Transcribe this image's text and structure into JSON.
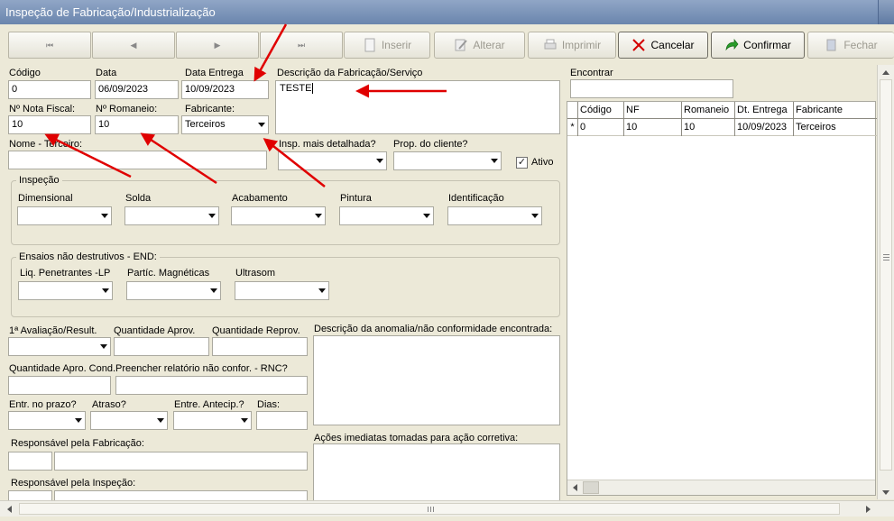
{
  "window": {
    "title": "Inspeção de Fabricação/Industrialização"
  },
  "nav": {
    "first": "⏮",
    "prev": "◀",
    "next": "▶",
    "last": "⏭"
  },
  "toolbar": {
    "insert": "Inserir",
    "edit": "Alterar",
    "print": "Imprimir",
    "cancel": "Cancelar",
    "confirm": "Confirmar",
    "close": "Fechar"
  },
  "form": {
    "codigo": {
      "label": "Código",
      "value": "0"
    },
    "data": {
      "label": "Data",
      "value": "06/09/2023"
    },
    "data_entrega": {
      "label": "Data Entrega",
      "value": "10/09/2023"
    },
    "descricao": {
      "label": "Descrição da Fabricação/Serviço",
      "value": "TESTE"
    },
    "nota_fiscal": {
      "label": "Nº Nota Fiscal:",
      "value": "10"
    },
    "romaneio": {
      "label": "Nº Romaneio:",
      "value": "10"
    },
    "fabricante": {
      "label": "Fabricante:",
      "value": "Terceiros"
    },
    "nome_terceiro": {
      "label": "Nome - Terceiro:",
      "value": ""
    },
    "insp_detalhada": {
      "label": "Insp. mais detalhada?",
      "value": ""
    },
    "prop_cliente": {
      "label": "Prop. do cliente?",
      "value": ""
    },
    "ativo": {
      "label": "Ativo",
      "checked": "✓"
    },
    "inspecao": {
      "title": "Inspeção",
      "dimensional": "Dimensional",
      "solda": "Solda",
      "acabamento": "Acabamento",
      "pintura": "Pintura",
      "identificacao": "Identificação"
    },
    "end": {
      "title": "Ensaios não destrutivos - END:",
      "liq": "Liq. Penetrantes -LP",
      "mag": "Partíc. Magnéticas",
      "ultra": "Ultrasom"
    },
    "avaliacao": "1ª Avaliação/Result.",
    "qtd_aprov": "Quantidade Aprov.",
    "qtd_reprov": "Quantidade Reprov.",
    "anomalia": "Descrição da anomalia/não conformidade encontrada:",
    "qtd_aprov_cond": "Quantidade Apro. Cond.",
    "rnc": "Preencher relatório não confor. - RNC?",
    "entr_prazo": "Entr. no prazo?",
    "atraso": "Atraso?",
    "entr_antecip": "Entre. Antecip.?",
    "dias": "Dias:",
    "resp_fabricacao": "Responsável pela Fabricação:",
    "acoes": "Ações imediatas tomadas para ação corretiva:",
    "resp_inspecao": "Responsável pela Inspeção:"
  },
  "search": {
    "label": "Encontrar",
    "value": ""
  },
  "grid": {
    "columns": [
      "Código",
      "NF",
      "Romaneio",
      "Dt. Entrega",
      "Fabricante"
    ],
    "rows": [
      {
        "marker": "*",
        "codigo": "0",
        "nf": "10",
        "romaneio": "10",
        "dt_entrega": "10/09/2023",
        "fabricante": "Terceiros"
      }
    ]
  },
  "colors": {
    "title_bar": "#7a93b8",
    "arrow": "#e00000",
    "background": "#ece9d8"
  }
}
